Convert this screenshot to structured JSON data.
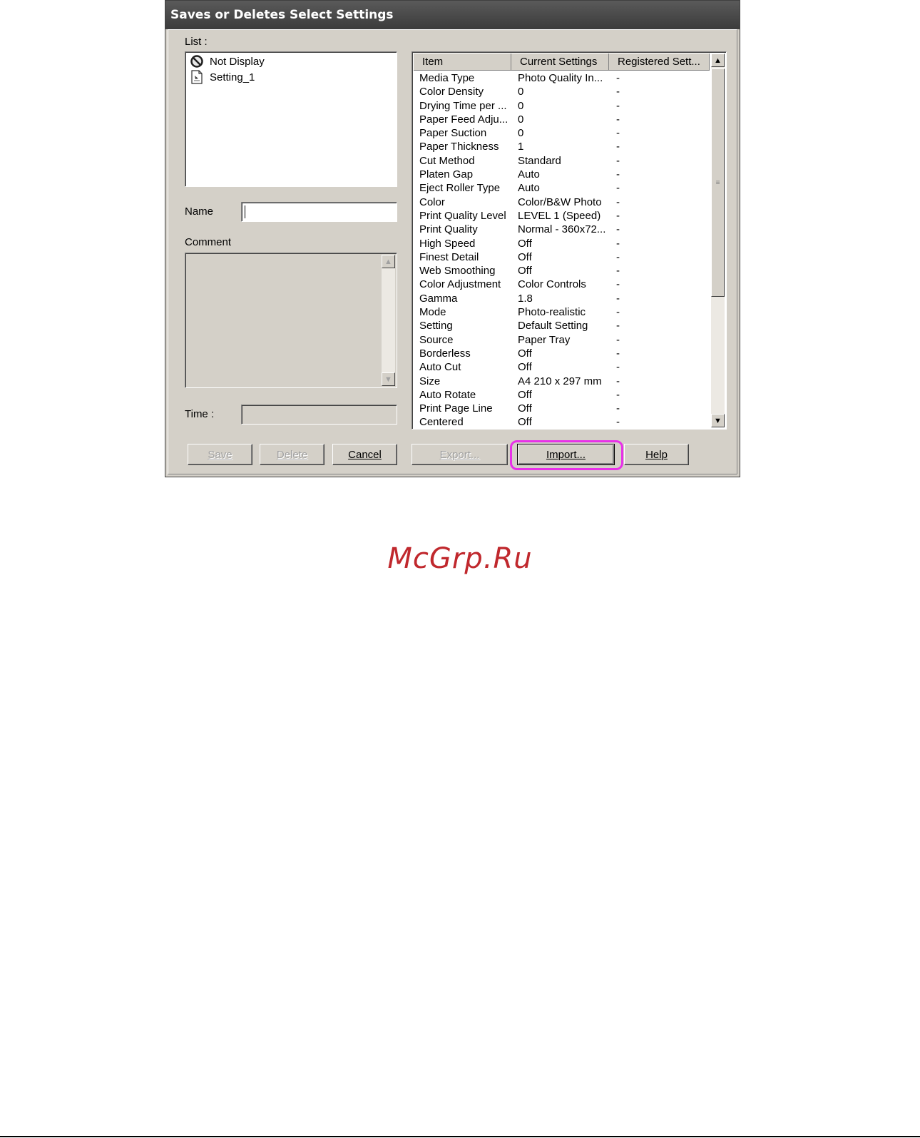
{
  "window": {
    "title": "Saves or Deletes Select Settings"
  },
  "list_section": {
    "label": "List :",
    "items": [
      {
        "label": "Not Display",
        "icon": "prohibited-icon"
      },
      {
        "label": "Setting_1",
        "icon": "settings-file-icon"
      }
    ]
  },
  "name_field": {
    "label": "Name",
    "value": ""
  },
  "comment_field": {
    "label": "Comment",
    "value": ""
  },
  "time_field": {
    "label": "Time :",
    "value": ""
  },
  "settings_table": {
    "headers": [
      "Item",
      "Current Settings",
      "Registered Sett..."
    ],
    "rows": [
      [
        "Media Type",
        "Photo Quality In...",
        "-"
      ],
      [
        "Color Density",
        "0",
        "-"
      ],
      [
        "Drying Time per ...",
        "0",
        "-"
      ],
      [
        "Paper Feed Adju...",
        "0",
        "-"
      ],
      [
        "Paper Suction",
        "0",
        "-"
      ],
      [
        "Paper Thickness",
        "1",
        "-"
      ],
      [
        "Cut Method",
        "Standard",
        "-"
      ],
      [
        "Platen Gap",
        "Auto",
        "-"
      ],
      [
        "Eject Roller Type",
        "Auto",
        "-"
      ],
      [
        "Color",
        "Color/B&W Photo",
        "-"
      ],
      [
        "Print Quality Level",
        "LEVEL 1 (Speed)",
        "-"
      ],
      [
        "Print Quality",
        "Normal - 360x72...",
        "-"
      ],
      [
        "High Speed",
        "Off",
        "-"
      ],
      [
        "Finest Detail",
        "Off",
        "-"
      ],
      [
        "Web Smoothing",
        "Off",
        "-"
      ],
      [
        "Color Adjustment",
        "Color Controls",
        "-"
      ],
      [
        "Gamma",
        "1.8",
        "-"
      ],
      [
        "Mode",
        "Photo-realistic",
        "-"
      ],
      [
        "Setting",
        "Default Setting",
        "-"
      ],
      [
        "Source",
        "Paper Tray",
        "-"
      ],
      [
        "Borderless",
        "Off",
        "-"
      ],
      [
        "Auto Cut",
        "Off",
        "-"
      ],
      [
        "Size",
        "A4 210 x 297 mm",
        "-"
      ],
      [
        "Auto Rotate",
        "Off",
        "-"
      ],
      [
        "Print Page Line",
        "Off",
        "-"
      ],
      [
        "Centered",
        "Off",
        "-"
      ]
    ]
  },
  "buttons": {
    "save": "Save",
    "delete": "Delete",
    "cancel": "Cancel",
    "export": "Export...",
    "import": "Import...",
    "help": "Help"
  },
  "watermark": "McGrp.Ru",
  "colors": {
    "highlight": "#e830e8",
    "watermark": "#c0282d",
    "dialog_bg": "#d4d0c8"
  }
}
